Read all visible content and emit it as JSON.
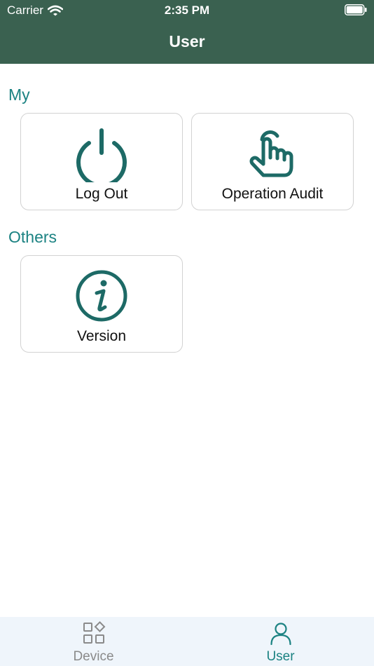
{
  "status_bar": {
    "carrier": "Carrier",
    "time": "2:35 PM",
    "wifi_icon": "wifi-icon",
    "battery_icon": "battery-icon"
  },
  "nav": {
    "title": "User"
  },
  "sections": [
    {
      "title": "My",
      "items": [
        {
          "label": "Log Out",
          "icon": "power-icon"
        },
        {
          "label": "Operation Audit",
          "icon": "tap-hand-icon"
        }
      ]
    },
    {
      "title": "Others",
      "items": [
        {
          "label": "Version",
          "icon": "info-icon"
        }
      ]
    }
  ],
  "tab_bar": {
    "tabs": [
      {
        "label": "Device",
        "icon": "device-grid-icon",
        "selected": false
      },
      {
        "label": "User",
        "icon": "user-icon",
        "selected": true
      }
    ]
  },
  "colors": {
    "header_bg": "#3a6150",
    "accent": "#1b8282",
    "icon": "#1d6a66",
    "tab_inactive": "#8a8a8a",
    "tab_bar_bg": "#eff5fb"
  }
}
